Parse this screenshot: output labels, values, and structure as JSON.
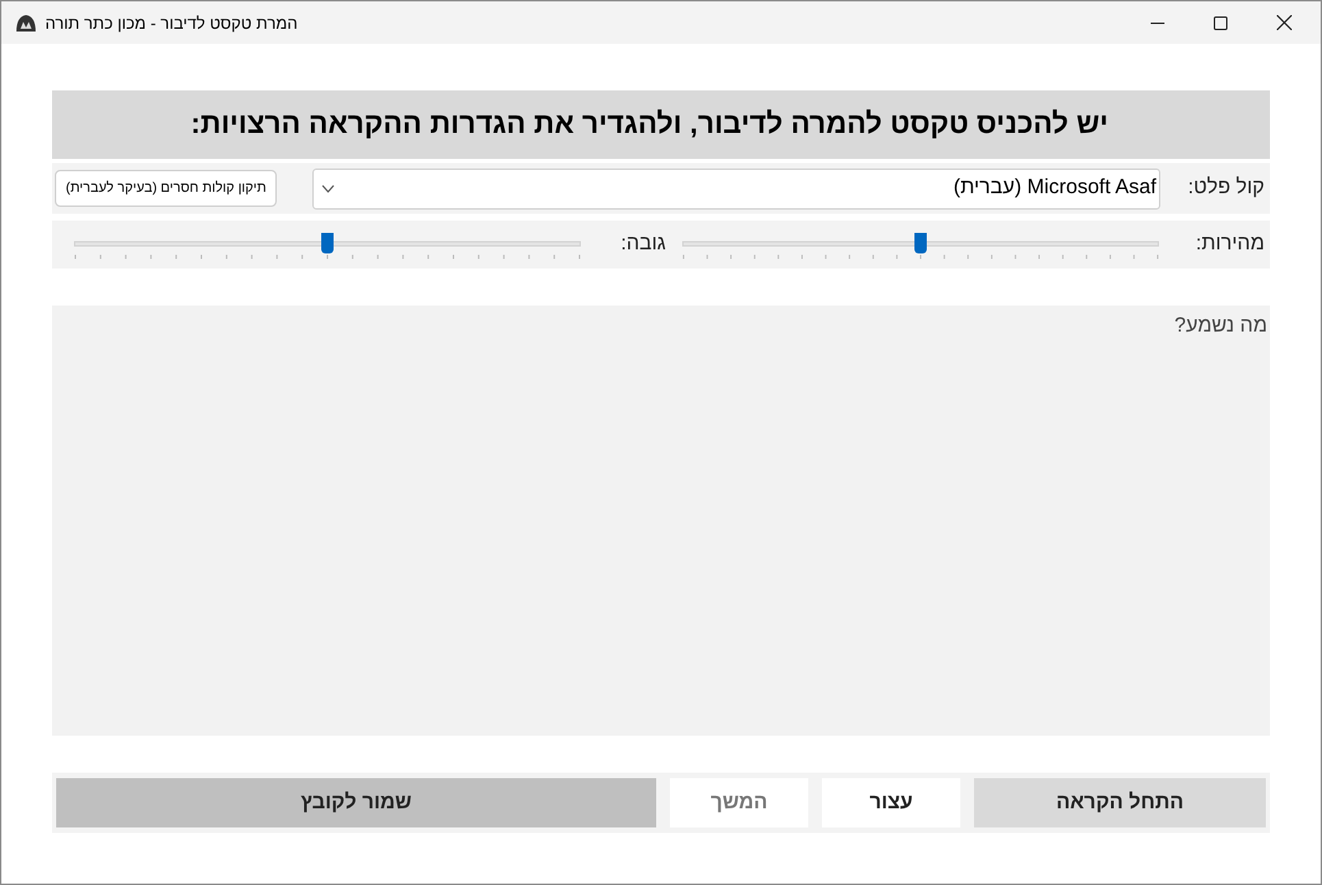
{
  "window": {
    "title": "המרת טקסט לדיבור - מכון כתר תורה"
  },
  "heading": "יש להכניס טקסט להמרה לדיבור, ולהגדיר את הגדרות ההקראה הרצויות:",
  "voice": {
    "label": "קול פלט:",
    "value": "Microsoft Asaf (עברית)"
  },
  "fix_button": "תיקון קולות חסרים (בעיקר לעברית)",
  "sliders": [
    {
      "label": "מהירות:",
      "level": 0.5
    },
    {
      "label": "גובה:",
      "level": 0.5
    }
  ],
  "text_area": {
    "value": "מה נשמע?"
  },
  "buttons": [
    {
      "label": "התחל הקראה",
      "kind": "normal",
      "disabled": false
    },
    {
      "label": "עצור",
      "kind": "plain",
      "disabled": false
    },
    {
      "label": "המשך",
      "kind": "plain",
      "disabled": true
    },
    {
      "label": "שמור לקובץ",
      "kind": "wide",
      "disabled": false
    }
  ]
}
